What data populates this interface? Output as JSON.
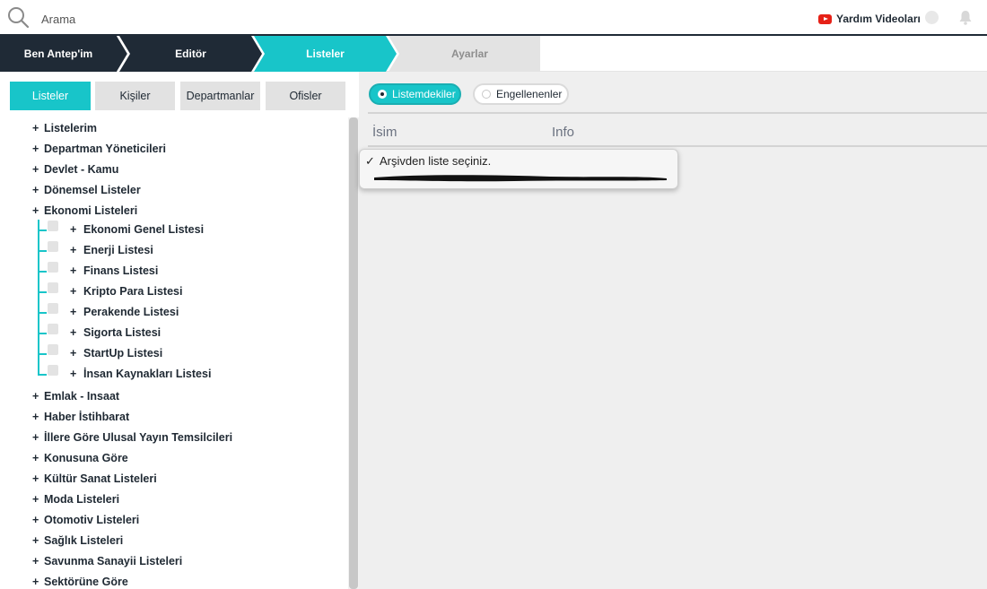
{
  "search": {
    "placeholder": "Arama"
  },
  "header": {
    "help_label": "Yardım Videoları"
  },
  "steps": [
    {
      "label": "Ben Antep'im"
    },
    {
      "label": "Editör"
    },
    {
      "label": "Listeler"
    },
    {
      "label": "Ayarlar"
    }
  ],
  "tabs": [
    {
      "label": "Listeler"
    },
    {
      "label": "Kişiler"
    },
    {
      "label": "Departmanlar"
    },
    {
      "label": "Ofisler"
    }
  ],
  "tree": {
    "top": [
      "Listelerim",
      "Departman Yöneticileri",
      "Devlet - Kamu",
      "Dönemsel Listeler",
      "Ekonomi Listeleri"
    ],
    "economy_children": [
      "Ekonomi Genel Listesi",
      "Enerji Listesi",
      "Finans Listesi",
      "Kripto Para Listesi",
      "Perakende Listesi",
      "Sigorta Listesi",
      "StartUp Listesi",
      "İnsan Kaynakları Listesi"
    ],
    "bottom": [
      "Emlak - Insaat",
      "Haber İstihbarat",
      "İllere Göre Ulusal Yayın Temsilcileri",
      "Konusuna Göre",
      "Kültür Sanat Listeleri",
      "Moda Listeleri",
      "Otomotiv Listeleri",
      "Sağlık Listeleri",
      "Savunma Sanayii Listeleri",
      "Sektörüne Göre"
    ]
  },
  "filters": {
    "included": "Listemdekiler",
    "blocked": "Engellenenler"
  },
  "table": {
    "col_name": "İsim",
    "col_info": "Info"
  },
  "dropdown": {
    "selected": "Arşivden liste seçiniz.",
    "check": "✓"
  },
  "colors": {
    "accent": "#18c5c9",
    "dark": "#1f2a36"
  }
}
